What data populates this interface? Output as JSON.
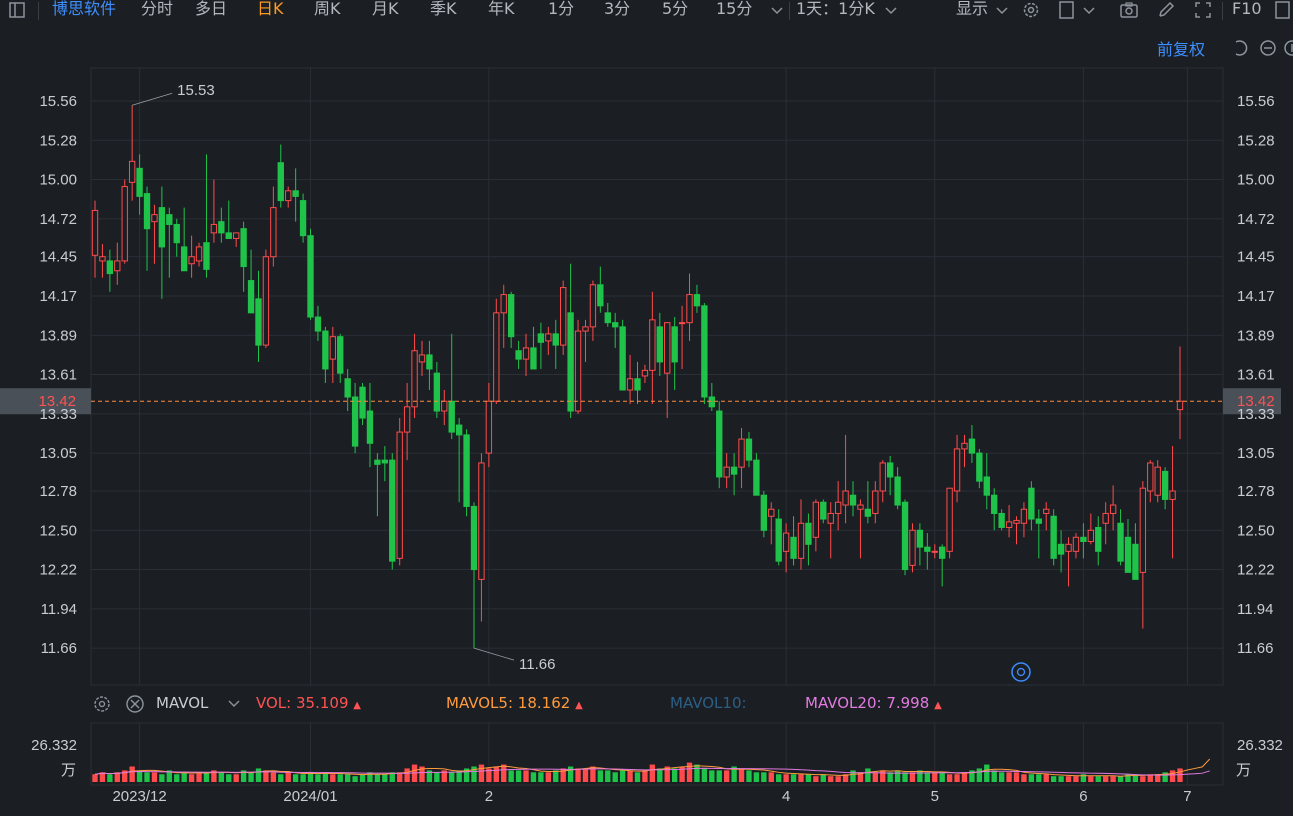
{
  "toolbar": {
    "brand": "博思软件",
    "tabs": [
      "分时",
      "多日",
      "日K",
      "周K",
      "月K",
      "季K",
      "年K",
      "1分",
      "3分",
      "5分",
      "15分"
    ],
    "active_tab": "日K",
    "period_select": "1天：1分K",
    "display_label": "显示",
    "f10_label": "F10"
  },
  "adjust_label": "前复权",
  "colors": {
    "up": "#ff4b4b",
    "down": "#20c34a",
    "grid": "#2a2f36",
    "bg": "#1b1f24",
    "brand": "#3d8fff",
    "active": "#ff9a1f",
    "current": "#ff8a3d"
  },
  "chart_data": [
    {
      "type": "candlestick",
      "title": "",
      "y_ticks": [
        "15.56",
        "15.28",
        "15.00",
        "14.72",
        "14.45",
        "14.17",
        "13.89",
        "13.61",
        "13.33",
        "13.05",
        "12.78",
        "12.50",
        "12.22",
        "11.94",
        "11.66"
      ],
      "ylim": [
        11.48,
        15.78
      ],
      "x_tick_labels": [
        "2023/12",
        "2024/01",
        "2",
        "4",
        "5",
        "6",
        "7"
      ],
      "current_price": "13.42",
      "high_label": "15.53",
      "low_label": "11.66",
      "candles": [
        {
          "o": 14.46,
          "h": 14.85,
          "l": 14.3,
          "c": 14.78
        },
        {
          "o": 14.42,
          "h": 14.54,
          "l": 14.3,
          "c": 14.45
        },
        {
          "o": 14.42,
          "h": 14.5,
          "l": 14.2,
          "c": 14.33
        },
        {
          "o": 14.35,
          "h": 14.55,
          "l": 14.25,
          "c": 14.42
        },
        {
          "o": 14.42,
          "h": 15.0,
          "l": 14.4,
          "c": 14.95
        },
        {
          "o": 14.98,
          "h": 15.53,
          "l": 14.85,
          "c": 15.13
        },
        {
          "o": 15.08,
          "h": 15.18,
          "l": 14.75,
          "c": 14.88
        },
        {
          "o": 14.9,
          "h": 14.95,
          "l": 14.35,
          "c": 14.65
        },
        {
          "o": 14.7,
          "h": 14.82,
          "l": 14.4,
          "c": 14.75
        },
        {
          "o": 14.8,
          "h": 14.95,
          "l": 14.15,
          "c": 14.52
        },
        {
          "o": 14.75,
          "h": 14.8,
          "l": 14.3,
          "c": 14.68
        },
        {
          "o": 14.68,
          "h": 14.72,
          "l": 14.45,
          "c": 14.55
        },
        {
          "o": 14.52,
          "h": 14.8,
          "l": 14.35,
          "c": 14.35
        },
        {
          "o": 14.4,
          "h": 14.6,
          "l": 14.3,
          "c": 14.45
        },
        {
          "o": 14.42,
          "h": 14.55,
          "l": 14.38,
          "c": 14.52
        },
        {
          "o": 14.55,
          "h": 15.18,
          "l": 14.3,
          "c": 14.36
        },
        {
          "o": 14.62,
          "h": 15.0,
          "l": 14.55,
          "c": 14.68
        },
        {
          "o": 14.7,
          "h": 14.8,
          "l": 14.55,
          "c": 14.62
        },
        {
          "o": 14.62,
          "h": 14.85,
          "l": 14.58,
          "c": 14.58
        },
        {
          "o": 14.58,
          "h": 14.6,
          "l": 14.52,
          "c": 14.62
        },
        {
          "o": 14.65,
          "h": 14.7,
          "l": 14.2,
          "c": 14.38
        },
        {
          "o": 14.28,
          "h": 14.5,
          "l": 14.2,
          "c": 14.05
        },
        {
          "o": 14.15,
          "h": 14.35,
          "l": 13.7,
          "c": 13.82
        },
        {
          "o": 13.82,
          "h": 14.5,
          "l": 13.8,
          "c": 14.45
        },
        {
          "o": 14.45,
          "h": 14.95,
          "l": 14.38,
          "c": 14.8
        },
        {
          "o": 15.12,
          "h": 15.25,
          "l": 14.8,
          "c": 14.85
        },
        {
          "o": 14.85,
          "h": 14.95,
          "l": 14.8,
          "c": 14.92
        },
        {
          "o": 14.92,
          "h": 15.08,
          "l": 14.7,
          "c": 14.88
        },
        {
          "o": 14.85,
          "h": 14.9,
          "l": 14.55,
          "c": 14.6
        },
        {
          "o": 14.6,
          "h": 14.65,
          "l": 14.0,
          "c": 14.02
        },
        {
          "o": 14.02,
          "h": 14.1,
          "l": 13.85,
          "c": 13.92
        },
        {
          "o": 13.92,
          "h": 13.95,
          "l": 13.55,
          "c": 13.65
        },
        {
          "o": 13.72,
          "h": 13.95,
          "l": 13.55,
          "c": 13.88
        },
        {
          "o": 13.88,
          "h": 13.9,
          "l": 13.55,
          "c": 13.62
        },
        {
          "o": 13.58,
          "h": 13.65,
          "l": 13.35,
          "c": 13.45
        },
        {
          "o": 13.45,
          "h": 13.55,
          "l": 13.05,
          "c": 13.1
        },
        {
          "o": 13.52,
          "h": 13.55,
          "l": 13.25,
          "c": 13.3
        },
        {
          "o": 13.35,
          "h": 13.55,
          "l": 12.95,
          "c": 13.12
        },
        {
          "o": 13.0,
          "h": 13.05,
          "l": 12.6,
          "c": 12.97
        },
        {
          "o": 13.0,
          "h": 13.1,
          "l": 12.85,
          "c": 12.98
        },
        {
          "o": 13.0,
          "h": 13.05,
          "l": 12.22,
          "c": 12.28
        },
        {
          "o": 12.3,
          "h": 13.3,
          "l": 12.25,
          "c": 13.2
        },
        {
          "o": 13.2,
          "h": 13.55,
          "l": 13.0,
          "c": 13.38
        },
        {
          "o": 13.38,
          "h": 13.9,
          "l": 13.3,
          "c": 13.78
        },
        {
          "o": 13.7,
          "h": 13.85,
          "l": 13.6,
          "c": 13.75
        },
        {
          "o": 13.75,
          "h": 13.85,
          "l": 13.5,
          "c": 13.65
        },
        {
          "o": 13.62,
          "h": 13.7,
          "l": 13.3,
          "c": 13.35
        },
        {
          "o": 13.35,
          "h": 13.5,
          "l": 13.25,
          "c": 13.42
        },
        {
          "o": 13.42,
          "h": 13.9,
          "l": 13.15,
          "c": 13.2
        },
        {
          "o": 13.25,
          "h": 13.3,
          "l": 12.7,
          "c": 13.18
        },
        {
          "o": 13.18,
          "h": 13.22,
          "l": 12.6,
          "c": 12.67
        },
        {
          "o": 12.67,
          "h": 12.7,
          "l": 11.66,
          "c": 12.22
        },
        {
          "o": 12.15,
          "h": 13.05,
          "l": 11.85,
          "c": 12.98
        },
        {
          "o": 13.05,
          "h": 13.55,
          "l": 12.95,
          "c": 13.42
        },
        {
          "o": 13.42,
          "h": 14.15,
          "l": 13.4,
          "c": 14.05
        },
        {
          "o": 14.05,
          "h": 14.25,
          "l": 13.8,
          "c": 14.18
        },
        {
          "o": 14.18,
          "h": 14.2,
          "l": 13.8,
          "c": 13.88
        },
        {
          "o": 13.78,
          "h": 13.85,
          "l": 13.65,
          "c": 13.72
        },
        {
          "o": 13.72,
          "h": 13.9,
          "l": 13.6,
          "c": 13.8
        },
        {
          "o": 13.8,
          "h": 13.95,
          "l": 13.7,
          "c": 13.65
        },
        {
          "o": 13.9,
          "h": 13.98,
          "l": 13.65,
          "c": 13.84
        },
        {
          "o": 13.85,
          "h": 13.95,
          "l": 13.75,
          "c": 13.9
        },
        {
          "o": 13.9,
          "h": 14.0,
          "l": 13.65,
          "c": 13.82
        },
        {
          "o": 13.82,
          "h": 14.28,
          "l": 13.75,
          "c": 14.23
        },
        {
          "o": 14.05,
          "h": 14.4,
          "l": 13.3,
          "c": 13.35
        },
        {
          "o": 13.35,
          "h": 14.0,
          "l": 13.33,
          "c": 13.92
        },
        {
          "o": 13.92,
          "h": 14.0,
          "l": 13.7,
          "c": 13.95
        },
        {
          "o": 13.95,
          "h": 14.28,
          "l": 13.85,
          "c": 14.25
        },
        {
          "o": 14.25,
          "h": 14.38,
          "l": 14.05,
          "c": 14.1
        },
        {
          "o": 14.05,
          "h": 14.12,
          "l": 13.95,
          "c": 13.98
        },
        {
          "o": 13.98,
          "h": 14.05,
          "l": 13.8,
          "c": 13.95
        },
        {
          "o": 13.95,
          "h": 14.0,
          "l": 13.5,
          "c": 13.5
        },
        {
          "o": 13.5,
          "h": 13.75,
          "l": 13.4,
          "c": 13.58
        },
        {
          "o": 13.58,
          "h": 13.7,
          "l": 13.4,
          "c": 13.5
        },
        {
          "o": 13.6,
          "h": 13.68,
          "l": 13.55,
          "c": 13.64
        },
        {
          "o": 13.64,
          "h": 14.2,
          "l": 13.4,
          "c": 14.0
        },
        {
          "o": 13.95,
          "h": 14.05,
          "l": 13.6,
          "c": 13.7
        },
        {
          "o": 13.62,
          "h": 13.95,
          "l": 13.3,
          "c": 13.98
        },
        {
          "o": 13.95,
          "h": 14.02,
          "l": 13.5,
          "c": 13.7
        },
        {
          "o": 13.98,
          "h": 14.1,
          "l": 13.65,
          "c": 13.98
        },
        {
          "o": 13.98,
          "h": 14.33,
          "l": 13.85,
          "c": 14.18
        },
        {
          "o": 14.18,
          "h": 14.25,
          "l": 14.05,
          "c": 14.1
        },
        {
          "o": 14.1,
          "h": 14.12,
          "l": 13.4,
          "c": 13.45
        },
        {
          "o": 13.45,
          "h": 13.55,
          "l": 13.35,
          "c": 13.38
        },
        {
          "o": 13.35,
          "h": 13.42,
          "l": 12.8,
          "c": 12.88
        },
        {
          "o": 12.88,
          "h": 13.05,
          "l": 12.8,
          "c": 12.95
        },
        {
          "o": 12.95,
          "h": 13.05,
          "l": 12.75,
          "c": 12.9
        },
        {
          "o": 12.95,
          "h": 13.23,
          "l": 12.8,
          "c": 13.15
        },
        {
          "o": 13.15,
          "h": 13.2,
          "l": 12.95,
          "c": 13.0
        },
        {
          "o": 13.0,
          "h": 13.05,
          "l": 12.75,
          "c": 12.75
        },
        {
          "o": 12.75,
          "h": 12.78,
          "l": 12.45,
          "c": 12.5
        },
        {
          "o": 12.6,
          "h": 12.7,
          "l": 12.4,
          "c": 12.65
        },
        {
          "o": 12.58,
          "h": 12.65,
          "l": 12.25,
          "c": 12.28
        },
        {
          "o": 12.35,
          "h": 12.55,
          "l": 12.2,
          "c": 12.48
        },
        {
          "o": 12.45,
          "h": 12.6,
          "l": 12.25,
          "c": 12.3
        },
        {
          "o": 12.3,
          "h": 12.72,
          "l": 12.22,
          "c": 12.55
        },
        {
          "o": 12.55,
          "h": 12.62,
          "l": 12.25,
          "c": 12.4
        },
        {
          "o": 12.45,
          "h": 12.72,
          "l": 12.35,
          "c": 12.7
        },
        {
          "o": 12.7,
          "h": 12.72,
          "l": 12.55,
          "c": 12.58
        },
        {
          "o": 12.55,
          "h": 12.7,
          "l": 12.3,
          "c": 12.62
        },
        {
          "o": 12.62,
          "h": 12.85,
          "l": 12.5,
          "c": 12.7
        },
        {
          "o": 12.68,
          "h": 13.18,
          "l": 12.55,
          "c": 12.78
        },
        {
          "o": 12.75,
          "h": 12.85,
          "l": 12.6,
          "c": 12.68
        },
        {
          "o": 12.65,
          "h": 12.72,
          "l": 12.3,
          "c": 12.68
        },
        {
          "o": 12.65,
          "h": 12.85,
          "l": 12.55,
          "c": 12.6
        },
        {
          "o": 12.62,
          "h": 12.85,
          "l": 12.55,
          "c": 12.78
        },
        {
          "o": 12.78,
          "h": 13.0,
          "l": 12.7,
          "c": 12.98
        },
        {
          "o": 12.98,
          "h": 13.03,
          "l": 12.75,
          "c": 12.88
        },
        {
          "o": 12.88,
          "h": 12.95,
          "l": 12.65,
          "c": 12.68
        },
        {
          "o": 12.7,
          "h": 12.72,
          "l": 12.18,
          "c": 12.22
        },
        {
          "o": 12.25,
          "h": 12.55,
          "l": 12.2,
          "c": 12.5
        },
        {
          "o": 12.5,
          "h": 12.55,
          "l": 12.25,
          "c": 12.38
        },
        {
          "o": 12.38,
          "h": 12.48,
          "l": 12.22,
          "c": 12.35
        },
        {
          "o": 12.35,
          "h": 12.4,
          "l": 12.3,
          "c": 12.35
        },
        {
          "o": 12.38,
          "h": 12.4,
          "l": 12.1,
          "c": 12.3
        },
        {
          "o": 12.35,
          "h": 12.8,
          "l": 12.3,
          "c": 12.8
        },
        {
          "o": 12.78,
          "h": 13.18,
          "l": 12.7,
          "c": 13.08
        },
        {
          "o": 13.08,
          "h": 13.18,
          "l": 12.95,
          "c": 13.12
        },
        {
          "o": 13.15,
          "h": 13.25,
          "l": 12.98,
          "c": 13.05
        },
        {
          "o": 13.05,
          "h": 13.08,
          "l": 12.8,
          "c": 12.85
        },
        {
          "o": 12.88,
          "h": 13.05,
          "l": 12.65,
          "c": 12.75
        },
        {
          "o": 12.75,
          "h": 12.8,
          "l": 12.5,
          "c": 12.62
        },
        {
          "o": 12.62,
          "h": 12.65,
          "l": 12.5,
          "c": 12.52
        },
        {
          "o": 12.52,
          "h": 12.68,
          "l": 12.45,
          "c": 12.56
        },
        {
          "o": 12.55,
          "h": 12.6,
          "l": 12.4,
          "c": 12.57
        },
        {
          "o": 12.55,
          "h": 12.7,
          "l": 12.45,
          "c": 12.65
        },
        {
          "o": 12.8,
          "h": 12.85,
          "l": 12.5,
          "c": 12.58
        },
        {
          "o": 12.58,
          "h": 12.65,
          "l": 12.3,
          "c": 12.55
        },
        {
          "o": 12.62,
          "h": 12.7,
          "l": 12.5,
          "c": 12.65
        },
        {
          "o": 12.6,
          "h": 12.65,
          "l": 12.25,
          "c": 12.3
        },
        {
          "o": 12.4,
          "h": 12.5,
          "l": 12.2,
          "c": 12.33
        },
        {
          "o": 12.35,
          "h": 12.45,
          "l": 12.1,
          "c": 12.4
        },
        {
          "o": 12.35,
          "h": 12.48,
          "l": 12.3,
          "c": 12.45
        },
        {
          "o": 12.45,
          "h": 12.55,
          "l": 12.3,
          "c": 12.42
        },
        {
          "o": 12.42,
          "h": 12.62,
          "l": 12.4,
          "c": 12.5
        },
        {
          "o": 12.52,
          "h": 12.6,
          "l": 12.25,
          "c": 12.35
        },
        {
          "o": 12.55,
          "h": 12.7,
          "l": 12.4,
          "c": 12.62
        },
        {
          "o": 12.62,
          "h": 12.82,
          "l": 12.5,
          "c": 12.68
        },
        {
          "o": 12.55,
          "h": 12.65,
          "l": 12.25,
          "c": 12.28
        },
        {
          "o": 12.45,
          "h": 12.58,
          "l": 12.2,
          "c": 12.2
        },
        {
          "o": 12.4,
          "h": 12.55,
          "l": 12.15,
          "c": 12.15
        },
        {
          "o": 12.2,
          "h": 12.85,
          "l": 11.8,
          "c": 12.8
        },
        {
          "o": 12.78,
          "h": 13.0,
          "l": 12.7,
          "c": 12.98
        },
        {
          "o": 12.75,
          "h": 13.0,
          "l": 12.7,
          "c": 12.95
        },
        {
          "o": 12.92,
          "h": 12.95,
          "l": 12.65,
          "c": 12.72
        },
        {
          "o": 12.72,
          "h": 13.1,
          "l": 12.3,
          "c": 12.78
        },
        {
          "o": 13.36,
          "h": 13.81,
          "l": 13.15,
          "c": 13.42
        }
      ]
    },
    {
      "type": "bar",
      "title": "",
      "indicator_label": "MAVOL",
      "vol_label": "VOL:",
      "vol_value": "35.109",
      "mavol5_label": "MAVOL5:",
      "mavol5_value": "18.162",
      "mavol10_label": "MAVOL10:",
      "mavol20_label": "MAVOL20:",
      "mavol20_value": "7.998",
      "axis_label_top": "26.332",
      "axis_unit": "万",
      "ylim": [
        0,
        26.332
      ],
      "values": [
        4,
        5,
        4,
        5,
        6,
        8,
        6,
        5,
        5,
        4,
        6,
        4,
        5,
        4,
        5,
        5,
        6,
        5,
        4,
        4,
        6,
        5,
        7,
        6,
        5,
        4,
        5,
        4,
        4,
        5,
        4,
        5,
        4,
        4,
        4,
        3,
        4,
        5,
        4,
        4,
        5,
        5,
        7,
        9,
        8,
        6,
        5,
        6,
        5,
        6,
        7,
        8,
        9,
        7,
        8,
        9,
        6,
        6,
        6,
        5,
        5,
        5,
        6,
        7,
        8,
        7,
        7,
        8,
        6,
        6,
        5,
        6,
        6,
        5,
        6,
        9,
        7,
        8,
        7,
        8,
        10,
        9,
        7,
        6,
        6,
        6,
        8,
        7,
        6,
        5,
        5,
        5,
        4,
        4,
        4,
        4,
        4,
        3,
        4,
        3,
        3,
        4,
        6,
        5,
        7,
        5,
        6,
        5,
        6,
        5,
        5,
        6,
        5,
        5,
        5,
        4,
        4,
        5,
        6,
        7,
        9,
        6,
        5,
        5,
        5,
        4,
        4,
        4,
        4,
        3,
        3,
        3,
        3,
        4,
        3,
        3,
        3,
        3,
        3,
        4,
        4,
        3,
        4,
        4,
        5,
        6,
        7,
        9,
        8,
        9,
        26.3
      ]
    }
  ]
}
